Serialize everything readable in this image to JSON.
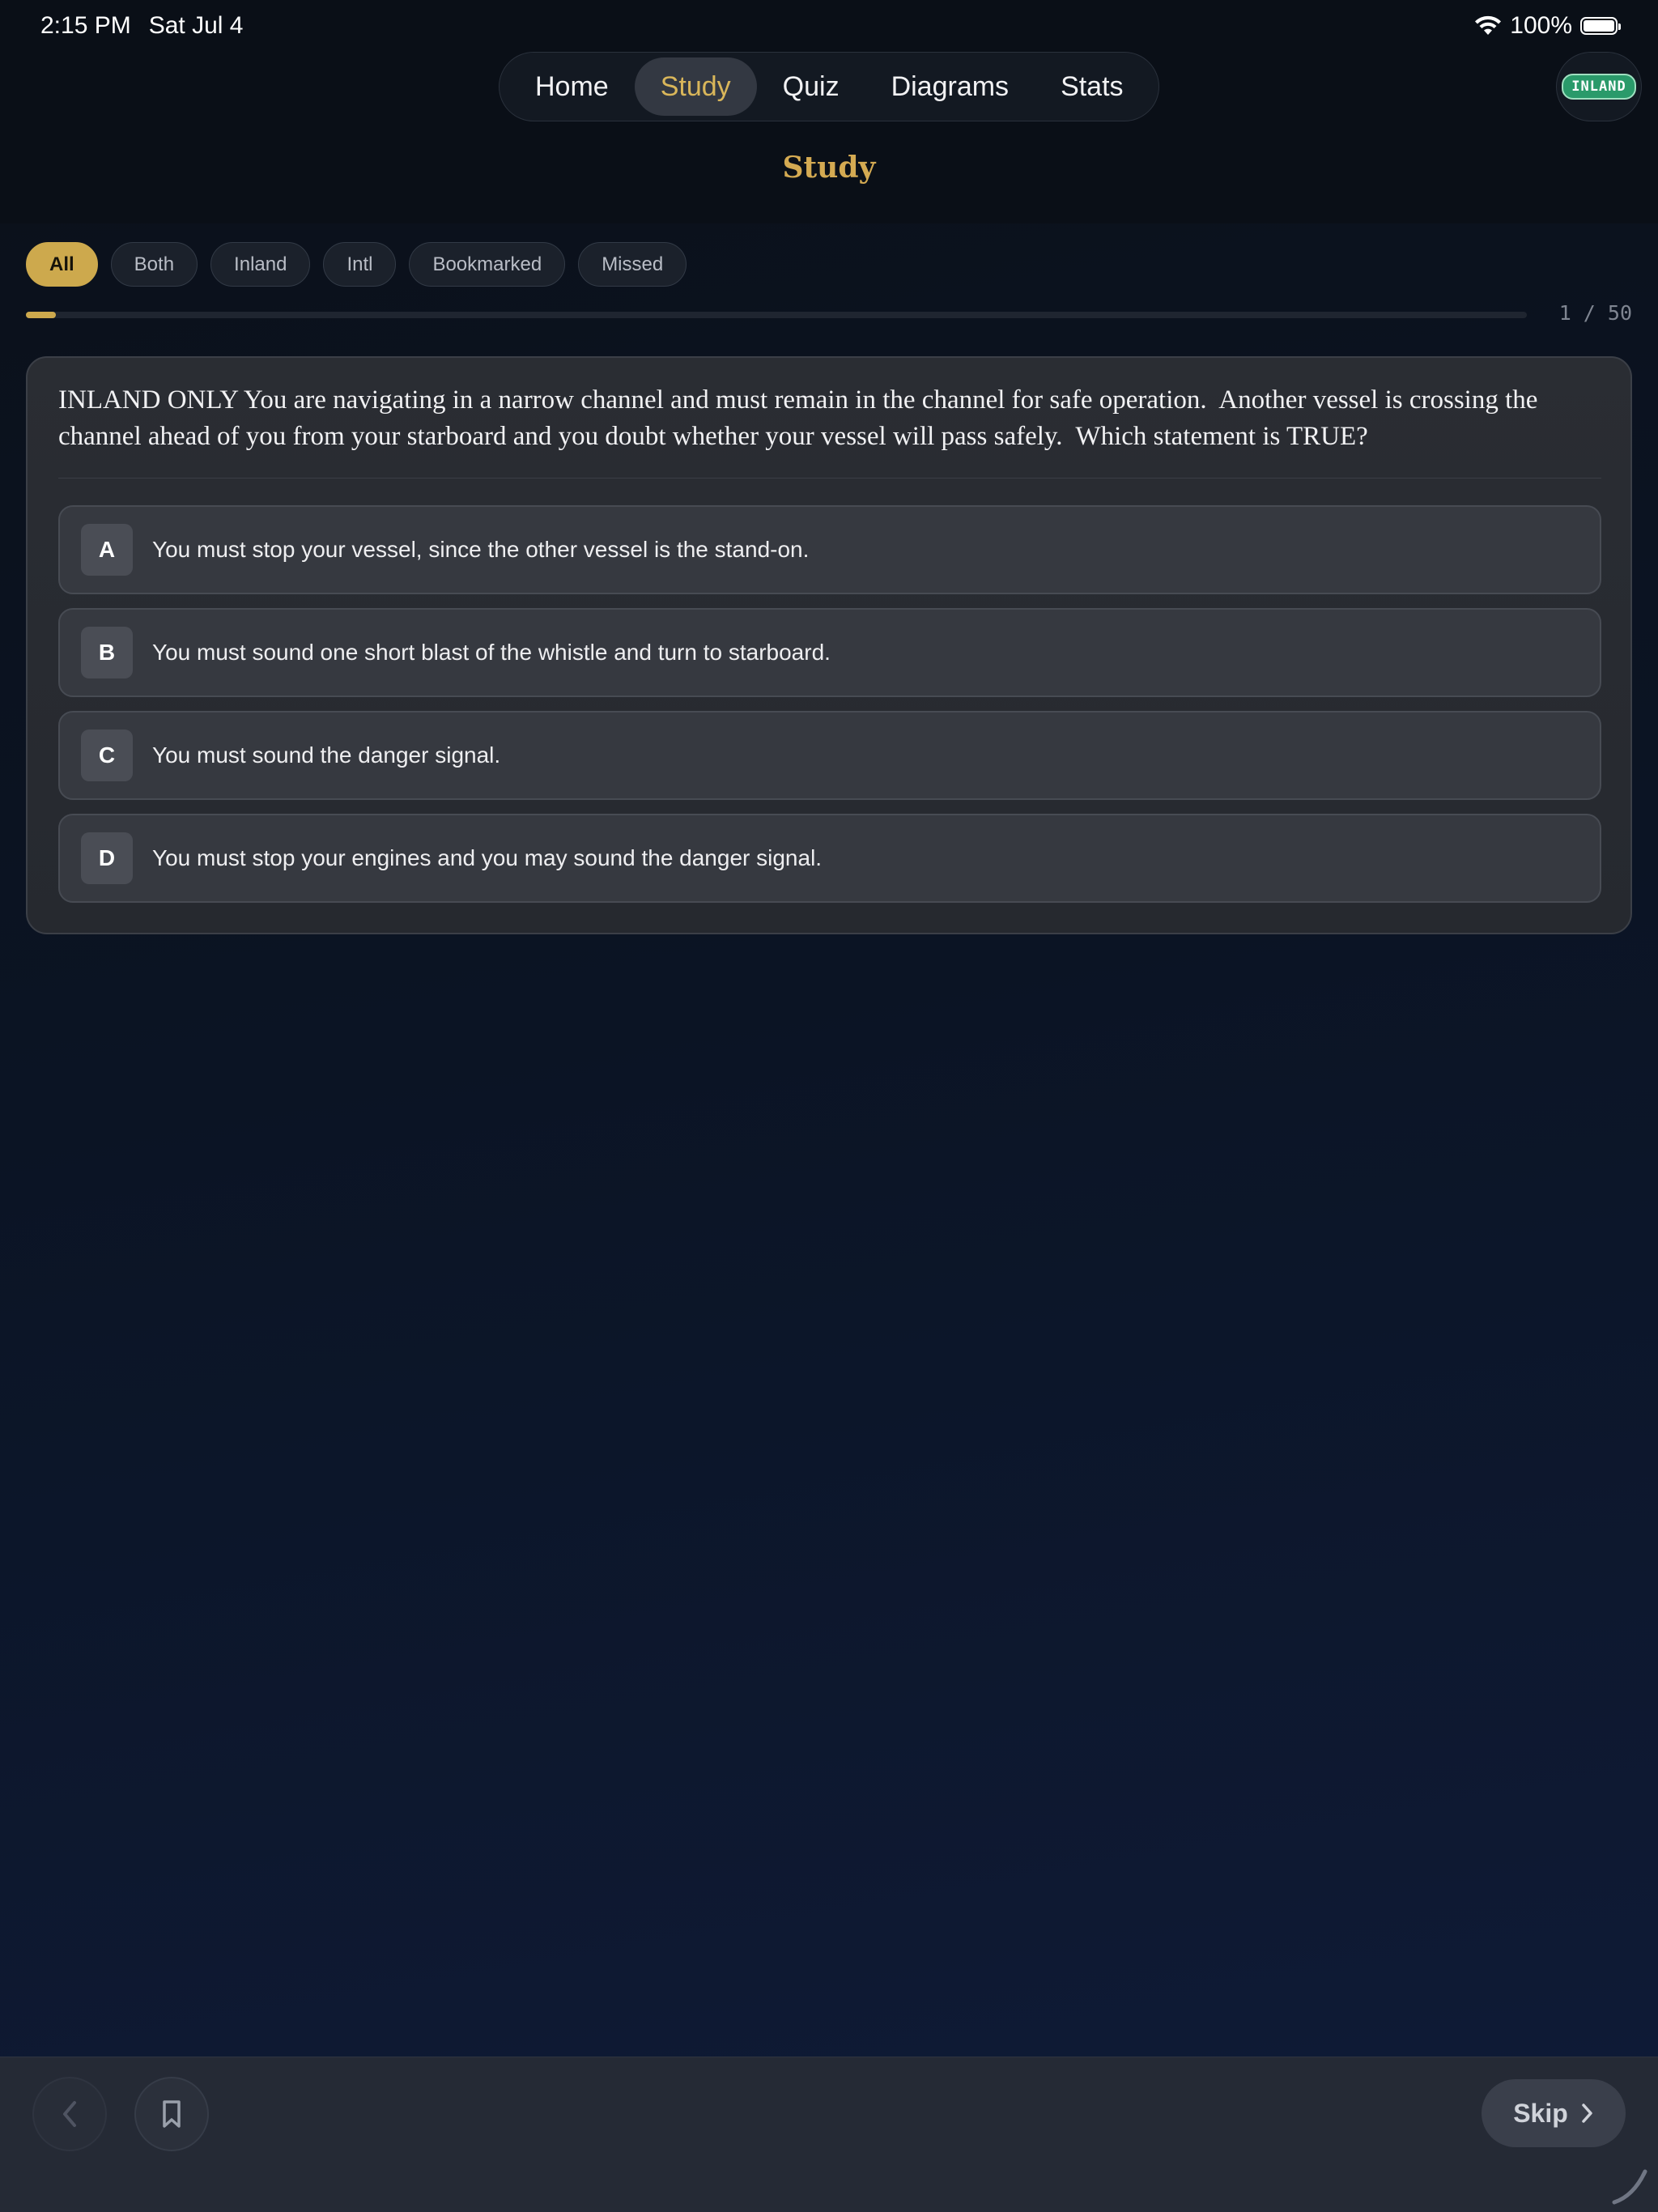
{
  "status_bar": {
    "time": "2:15 PM",
    "date": "Sat Jul 4",
    "battery": "100%"
  },
  "nav": {
    "tabs": [
      {
        "label": "Home",
        "active": false
      },
      {
        "label": "Study",
        "active": true
      },
      {
        "label": "Quiz",
        "active": false
      },
      {
        "label": "Diagrams",
        "active": false
      },
      {
        "label": "Stats",
        "active": false
      }
    ],
    "mode_badge": "INLAND"
  },
  "page": {
    "title": "Study"
  },
  "filters": [
    {
      "label": "All",
      "active": true
    },
    {
      "label": "Both",
      "active": false
    },
    {
      "label": "Inland",
      "active": false
    },
    {
      "label": "Intl",
      "active": false
    },
    {
      "label": "Bookmarked",
      "active": false
    },
    {
      "label": "Missed",
      "active": false
    }
  ],
  "progress": {
    "current": 1,
    "total": 50,
    "label": "1 / 50"
  },
  "question": {
    "text": "INLAND ONLY You are navigating in a narrow channel and must remain in the channel for safe operation.  Another vessel is crossing the channel ahead of you from your starboard and you doubt whether your vessel will pass safely.  Which statement is TRUE?",
    "answers": [
      {
        "letter": "A",
        "text": "You must stop your vessel, since the other vessel is the stand-on."
      },
      {
        "letter": "B",
        "text": "You must sound one short blast of the whistle and turn to starboard."
      },
      {
        "letter": "C",
        "text": "You must sound the danger signal."
      },
      {
        "letter": "D",
        "text": "You must stop your engines and you may sound the danger signal."
      }
    ]
  },
  "bottom_bar": {
    "skip_label": "Skip"
  },
  "colors": {
    "accent": "#cda94d",
    "title_gold": "#d4aa52",
    "badge_green": "#2a9a6a"
  },
  "icons": {
    "wifi": "wifi-icon",
    "battery": "battery-icon",
    "back": "chevron-left-icon",
    "bookmark": "bookmark-icon",
    "skip": "chevron-right-icon"
  }
}
